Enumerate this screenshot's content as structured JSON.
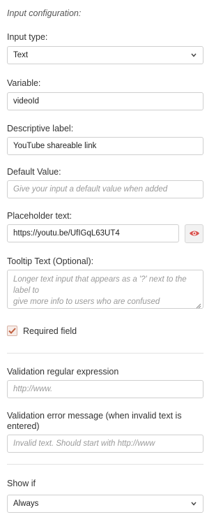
{
  "heading": "Input configuration:",
  "input_type": {
    "label": "Input type:",
    "value": "Text"
  },
  "variable": {
    "label": "Variable:",
    "value": "videoId"
  },
  "descriptive_label": {
    "label": "Descriptive label:",
    "value": "YouTube shareable link"
  },
  "default_value": {
    "label": "Default Value:",
    "placeholder": "Give your input a default value when added"
  },
  "placeholder_text": {
    "label": "Placeholder text:",
    "value": "https://youtu.be/UfIGqL63UT4",
    "preview_icon": "eye-icon"
  },
  "tooltip": {
    "label": "Tooltip Text (Optional):",
    "placeholder_line1": "Longer text input that appears as a '?' next to the label to",
    "placeholder_line2": "give more info to users who are confused"
  },
  "required": {
    "label": "Required field",
    "checked": true
  },
  "validation_regex": {
    "label": "Validation regular expression",
    "placeholder": "http://www."
  },
  "validation_error": {
    "label_line1": "Validation error message (when invalid text is",
    "label_line2": "entered)",
    "placeholder": "Invalid text. Should start with http://www"
  },
  "show_if": {
    "label": "Show if",
    "value": "Always"
  },
  "colors": {
    "accent": "#d9534f",
    "check": "#c0603f",
    "border": "#cfcfcf"
  }
}
